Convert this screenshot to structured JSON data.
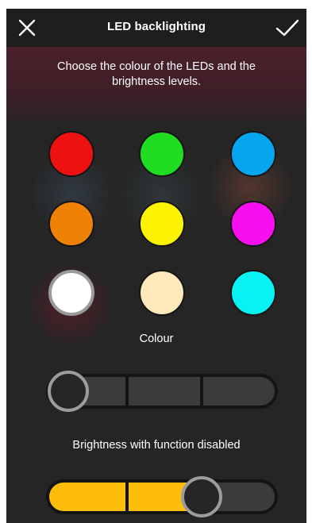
{
  "header": {
    "title": "LED backlighting",
    "close_icon": "close-icon",
    "confirm_icon": "checkmark-icon"
  },
  "description": "Choose the colour of the LEDs and the brightness levels.",
  "colours": [
    {
      "name": "red",
      "color": "#ee1111",
      "selected": false
    },
    {
      "name": "green",
      "color": "#21dd21",
      "selected": false
    },
    {
      "name": "blue",
      "color": "#05a6ee",
      "selected": false
    },
    {
      "name": "orange",
      "color": "#ef8204",
      "selected": false
    },
    {
      "name": "yellow",
      "color": "#fcf300",
      "selected": false
    },
    {
      "name": "magenta",
      "color": "#f70ff0",
      "selected": false
    },
    {
      "name": "white",
      "color": "#ffffff",
      "selected": true
    },
    {
      "name": "cream",
      "color": "#ffe8ba",
      "selected": false
    },
    {
      "name": "cyan",
      "color": "#06f2f3",
      "selected": false
    }
  ],
  "colour_label": "Colour",
  "brightness_enabled": {
    "level": 0,
    "max_level": 3
  },
  "brightness_disabled": {
    "label": "Brightness with function disabled",
    "level": 2,
    "max_level": 3
  },
  "accent_color": "#ffbd0b"
}
